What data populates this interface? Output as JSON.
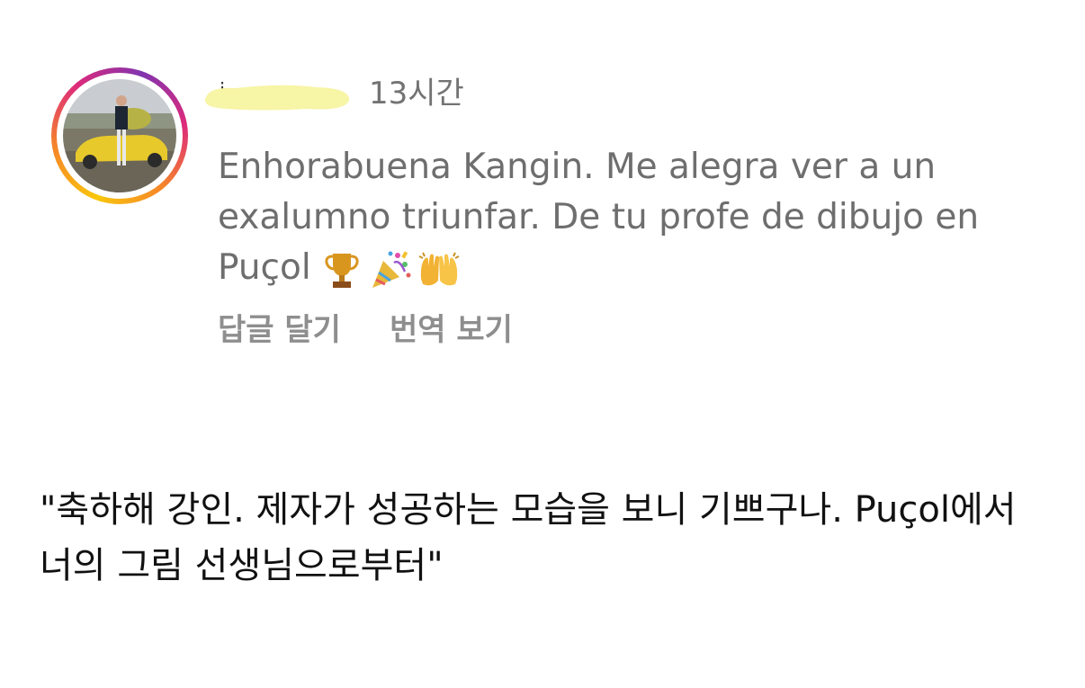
{
  "comment": {
    "avatar_alt": "profile photo: person standing beside a yellow convertible",
    "time": "13시간",
    "text": "Enhorabuena Kangin. Me alegra ver a un exalumno triunfar. De tu profe de dibujo en Puçol",
    "emojis": [
      "trophy-icon",
      "party-popper-icon",
      "raising-hands-icon"
    ],
    "actions": {
      "reply_label": "답글 달기",
      "translate_label": "번역 보기"
    }
  },
  "translation_note": {
    "text": "\"축하해 강인. 제자가 성공하는 모습을 보니 기쁘구나.  Puçol에서 너의 그림 선생님으로부터\""
  },
  "colors": {
    "ring_gradient": [
      "#f9c60c",
      "#f58529",
      "#dd2a7b",
      "#8134af"
    ],
    "redaction_highlight": "#f7f5a6",
    "secondary_text": "#737373"
  }
}
